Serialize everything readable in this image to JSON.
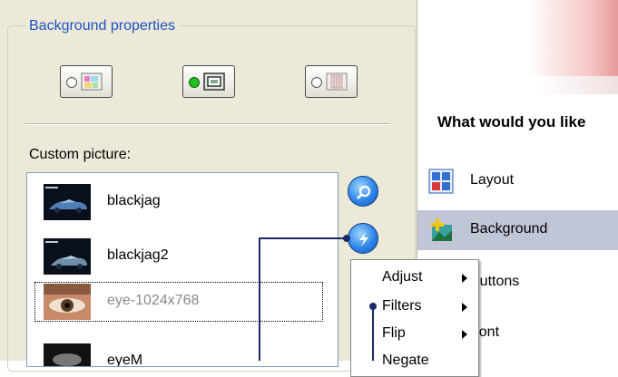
{
  "left_panel": {
    "group_title": "Background properties",
    "mode_buttons": [
      {
        "name": "color-mode",
        "selected": false
      },
      {
        "name": "picture-mode",
        "selected": true
      },
      {
        "name": "slideshow-mode",
        "selected": false
      }
    ],
    "custom_picture_label": "Custom picture:",
    "pictures": [
      {
        "name": "blackjag"
      },
      {
        "name": "blackjag2"
      },
      {
        "name": "eye-1024x768"
      },
      {
        "name": "eyeM"
      }
    ]
  },
  "right_panel": {
    "question": "What would you like",
    "menu": [
      {
        "label": "Layout"
      },
      {
        "label": "Background"
      },
      {
        "label": "Buttons"
      },
      {
        "label": "Font"
      }
    ]
  },
  "context_menu": {
    "items": [
      {
        "label": "Adjust"
      },
      {
        "label": "Filters"
      },
      {
        "label": "Flip"
      },
      {
        "label": "Negate"
      }
    ]
  },
  "colors": {
    "panel_bg": "#ece9d8",
    "group_title": "#1c52c4",
    "active_menu": "#c0c6d6",
    "callout_line": "#1a2a6c"
  }
}
